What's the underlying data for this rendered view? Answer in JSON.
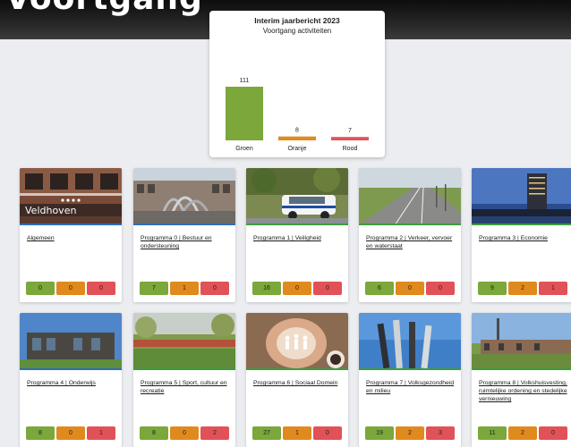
{
  "header": {
    "title": "Voortgang"
  },
  "chart_data": {
    "type": "bar",
    "title": "Interim jaarbericht 2023",
    "subtitle": "Voortgang activiteiten",
    "categories": [
      "Groen",
      "Oranje",
      "Rood"
    ],
    "values": [
      111,
      8,
      7
    ],
    "colors": [
      "#7ba73b",
      "#e08a1e",
      "#e05257"
    ]
  },
  "cards": [
    {
      "title": "Algemeen",
      "counts": [
        "0",
        "0",
        "0"
      ],
      "image": "veldhoven-building-photo"
    },
    {
      "title": "Programma 0 | Bestuur en ondersteuning",
      "counts": [
        "7",
        "1",
        "0"
      ],
      "image": "town-hall-sculpture-photo"
    },
    {
      "title": "Programma 1 | Veiligheid",
      "counts": [
        "16",
        "0",
        "0"
      ],
      "image": "police-car-photo"
    },
    {
      "title": "Programma 2 | Verkeer, vervoer en waterstaat",
      "counts": [
        "6",
        "0",
        "0"
      ],
      "image": "highway-photo"
    },
    {
      "title": "Programma 3 | Economie",
      "counts": [
        "9",
        "2",
        "1"
      ],
      "image": "hotel-tower-photo"
    },
    {
      "title": "Programma 4 | Onderwijs",
      "counts": [
        "8",
        "0",
        "1"
      ],
      "image": "school-building-photo"
    },
    {
      "title": "Programma 5 | Sport, cultuur en recreatie",
      "counts": [
        "8",
        "0",
        "2"
      ],
      "image": "sports-track-photo"
    },
    {
      "title": "Programma 6 | Sociaal Domein",
      "counts": [
        "27",
        "1",
        "0"
      ],
      "image": "family-hands-photo"
    },
    {
      "title": "Programma 7 | Volksgezondheid en milieu",
      "counts": [
        "19",
        "2",
        "3"
      ],
      "image": "sculpture-pillars-photo"
    },
    {
      "title": "Programma 8 | Volkshuisvesting, ruimtelijke ordening en stedelijke vernieuwing",
      "counts": [
        "11",
        "2",
        "0"
      ],
      "image": "houses-church-photo"
    }
  ]
}
